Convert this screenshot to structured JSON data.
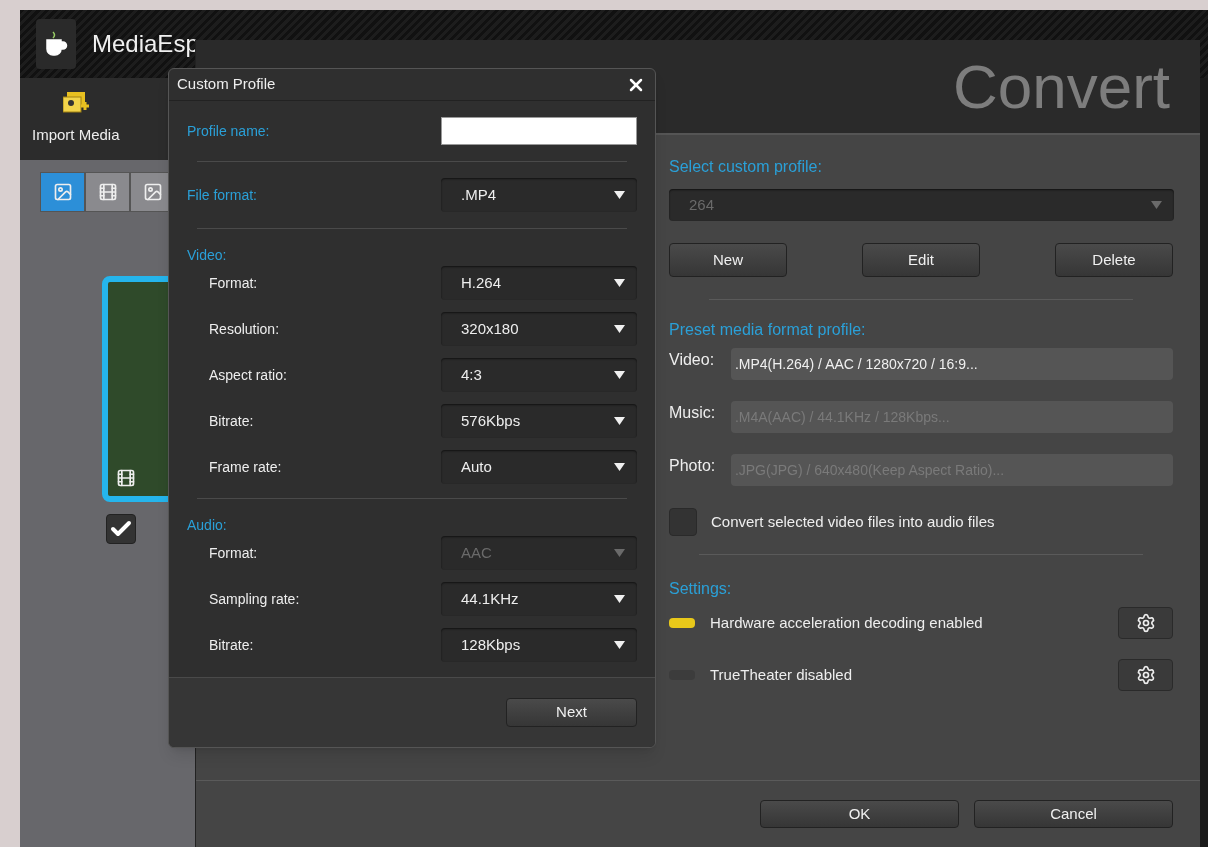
{
  "app": {
    "title": "MediaEsp",
    "toolbar": [
      {
        "label": "Import Media"
      }
    ],
    "view_tabs": [
      {
        "kind": "media",
        "selected": true
      },
      {
        "kind": "video",
        "selected": false
      },
      {
        "kind": "photo",
        "selected": false
      }
    ],
    "thumbnail": {
      "selected": true,
      "checked": true
    }
  },
  "convert_dialog": {
    "title": "Convert",
    "custom_profile": {
      "label": "Select custom profile:",
      "value": "264",
      "disabled": true
    },
    "profile_buttons": [
      "New",
      "Edit",
      "Delete"
    ],
    "preset": {
      "heading": "Preset media format profile:",
      "rows": [
        {
          "label": "Video:",
          "value": ".MP4(H.264) / AAC / 1280x720 / 16:9...",
          "disabled": false
        },
        {
          "label": "Music:",
          "value": ".M4A(AAC) / 44.1KHz / 128Kbps...",
          "disabled": true
        },
        {
          "label": "Photo:",
          "value": ".JPG(JPG) / 640x480(Keep Aspect Ratio)...",
          "disabled": true
        }
      ]
    },
    "audio_option": {
      "label": "Convert selected video files into audio files",
      "checked": false
    },
    "settings": {
      "heading": "Settings:",
      "items": [
        {
          "label": "Hardware acceleration decoding enabled",
          "on": true
        },
        {
          "label": "TrueTheater disabled",
          "on": false
        }
      ]
    },
    "buttons": [
      "OK",
      "Cancel"
    ]
  },
  "custom_profile_dialog": {
    "title": "Custom Profile",
    "profile_name": {
      "label": "Profile name:"
    },
    "file_format": {
      "label": "File format:",
      "value": ".MP4",
      "disabled": false
    },
    "sections": [
      {
        "heading": "Video:",
        "fields": [
          {
            "label": "Format:",
            "value": "H.264",
            "disabled": false
          },
          {
            "label": "Resolution:",
            "value": "320x180",
            "disabled": false
          },
          {
            "label": "Aspect ratio:",
            "value": "4:3",
            "disabled": false
          },
          {
            "label": "Bitrate:",
            "value": "576Kbps",
            "disabled": false
          },
          {
            "label": "Frame rate:",
            "value": "Auto",
            "disabled": false
          }
        ]
      },
      {
        "heading": "Audio:",
        "fields": [
          {
            "label": "Format:",
            "value": "AAC",
            "disabled": true
          },
          {
            "label": "Sampling rate:",
            "value": "44.1KHz",
            "disabled": false
          },
          {
            "label": "Bitrate:",
            "value": "128Kbps",
            "disabled": false
          }
        ]
      }
    ],
    "next_button": "Next"
  }
}
